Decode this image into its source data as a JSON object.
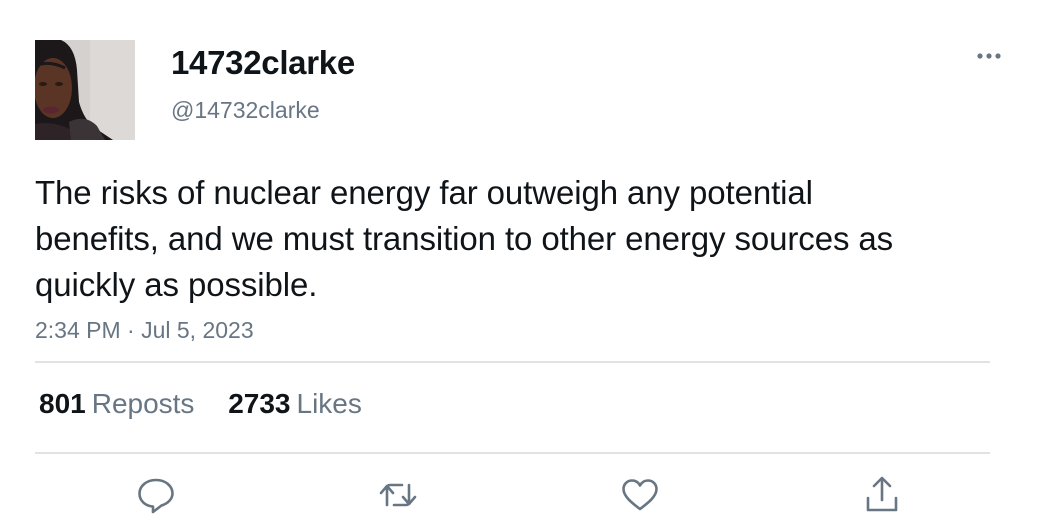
{
  "user": {
    "display_name": "14732clarke",
    "handle": "@14732clarke"
  },
  "tweet": {
    "text": "The risks of nuclear energy far outweigh any potential benefits, and we must transition to other energy sources as quickly as possible.",
    "timestamp": "2:34 PM · Jul 5, 2023"
  },
  "stats": {
    "reposts_count": "801",
    "reposts_label": "Reposts",
    "likes_count": "2733",
    "likes_label": "Likes"
  },
  "icons": {
    "more": "more-horizontal-icon",
    "reply": "reply-icon",
    "retweet": "retweet-icon",
    "like": "heart-icon",
    "share": "share-icon"
  },
  "colors": {
    "text_primary": "#0f1419",
    "text_secondary": "#687684",
    "icon": "#687684",
    "divider": "#dfe3e6"
  }
}
